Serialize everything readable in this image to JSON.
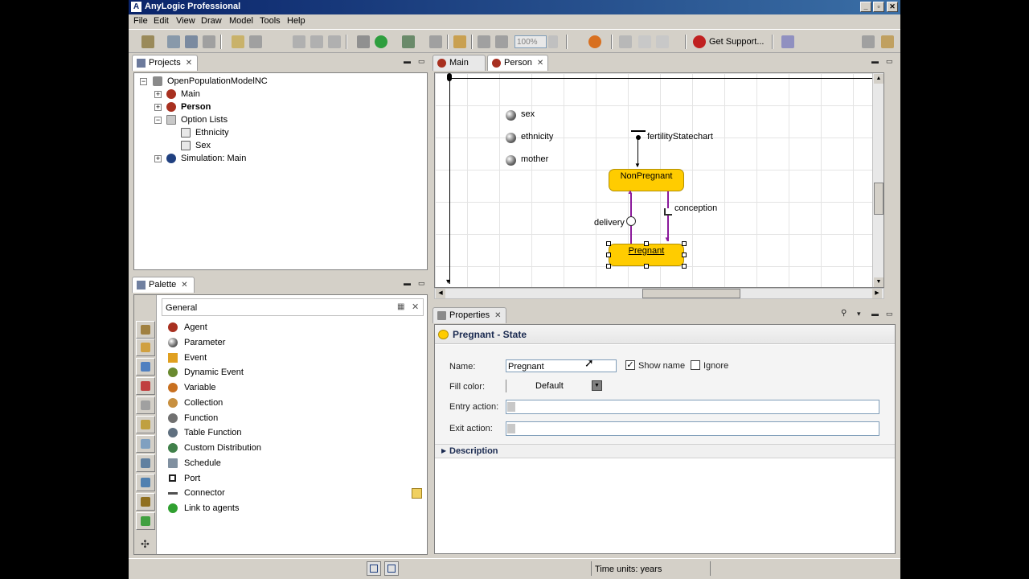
{
  "window": {
    "title": "AnyLogic Professional"
  },
  "menu": {
    "items": [
      "File",
      "Edit",
      "View",
      "Draw",
      "Model",
      "Tools",
      "Help"
    ]
  },
  "toolbar": {
    "zoom": "100%",
    "get_support": "Get Support..."
  },
  "projects": {
    "tab_label": "Projects",
    "tree": {
      "root": "OpenPopulationModelNC",
      "main": "Main",
      "person": "Person",
      "option_lists": "Option Lists",
      "ethnicity": "Ethnicity",
      "sex": "Sex",
      "simulation": "Simulation: Main"
    }
  },
  "palette": {
    "tab_label": "Palette",
    "section": "General",
    "items": [
      "Agent",
      "Parameter",
      "Event",
      "Dynamic Event",
      "Variable",
      "Collection",
      "Function",
      "Table Function",
      "Custom Distribution",
      "Schedule",
      "Port",
      "Connector",
      "Link to agents"
    ]
  },
  "editor": {
    "tabs": [
      "Main",
      "Person"
    ],
    "parameters": [
      "sex",
      "ethnicity",
      "mother"
    ],
    "statechart": {
      "name": "fertilityStatechart",
      "states": [
        "NonPregnant",
        "Pregnant"
      ],
      "transitions": {
        "conception": "conception",
        "delivery": "delivery"
      }
    }
  },
  "properties": {
    "tab_label": "Properties",
    "heading": "Pregnant - State",
    "name_label": "Name:",
    "name_value": "Pregnant",
    "show_name_label": "Show name",
    "show_name_checked": true,
    "ignore_label": "Ignore",
    "ignore_checked": false,
    "fill_color_label": "Fill color:",
    "fill_color_value": "Default",
    "entry_action_label": "Entry action:",
    "exit_action_label": "Exit action:",
    "description_label": "Description"
  },
  "status": {
    "time_units": "Time units: years"
  },
  "colors": {
    "state_fill": "#ffcc00",
    "transition": "#8b1a9b",
    "titlebar": "#0a246a"
  }
}
